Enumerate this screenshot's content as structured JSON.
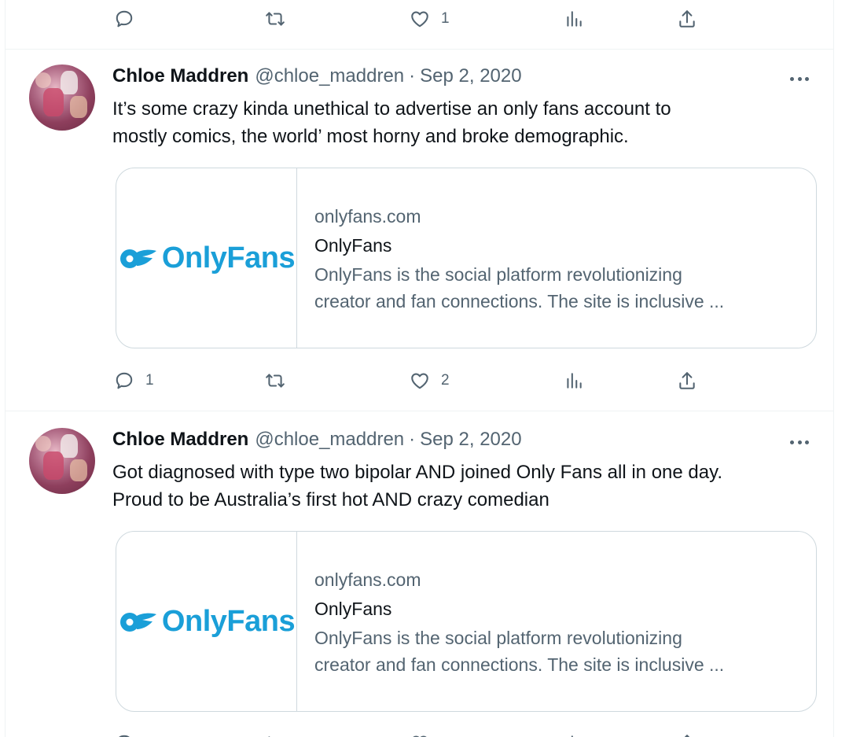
{
  "top_actions": {
    "reply_count": "",
    "retweet_count": "",
    "like_count": "1",
    "views_count": ""
  },
  "tweets": [
    {
      "author_name": "Chloe Maddren",
      "handle": "@chloe_maddren",
      "separator": "·",
      "date": "Sep 2, 2020",
      "text_line1": "It’s some crazy kinda unethical to advertise an only fans account to",
      "text_line2": "mostly comics, the world’ most horny and broke demographic.",
      "card": {
        "logo_text": "OnlyFans",
        "domain": "onlyfans.com",
        "title": "OnlyFans",
        "desc_line1": "OnlyFans is the social platform revolutionizing",
        "desc_line2": "creator and fan connections. The site is inclusive ..."
      },
      "actions": {
        "reply_count": "1",
        "retweet_count": "",
        "like_count": "2",
        "views_count": ""
      }
    },
    {
      "author_name": "Chloe Maddren",
      "handle": "@chloe_maddren",
      "separator": "·",
      "date": "Sep 2, 2020",
      "text_line1": "Got diagnosed with type two bipolar AND joined Only Fans all in one day.",
      "text_line2": "Proud to be Australia’s first hot AND crazy comedian",
      "card": {
        "logo_text": "OnlyFans",
        "domain": "onlyfans.com",
        "title": "OnlyFans",
        "desc_line1": "OnlyFans is the social platform revolutionizing",
        "desc_line2": "creator and fan connections. The site is inclusive ..."
      }
    }
  ],
  "colors": {
    "text_primary": "#0f1419",
    "text_secondary": "#536471",
    "border": "#cfd9de",
    "onlyfans_blue": "#1a9fd8"
  },
  "icons": [
    "reply-icon",
    "retweet-icon",
    "like-icon",
    "views-icon",
    "share-icon",
    "more-icon"
  ]
}
